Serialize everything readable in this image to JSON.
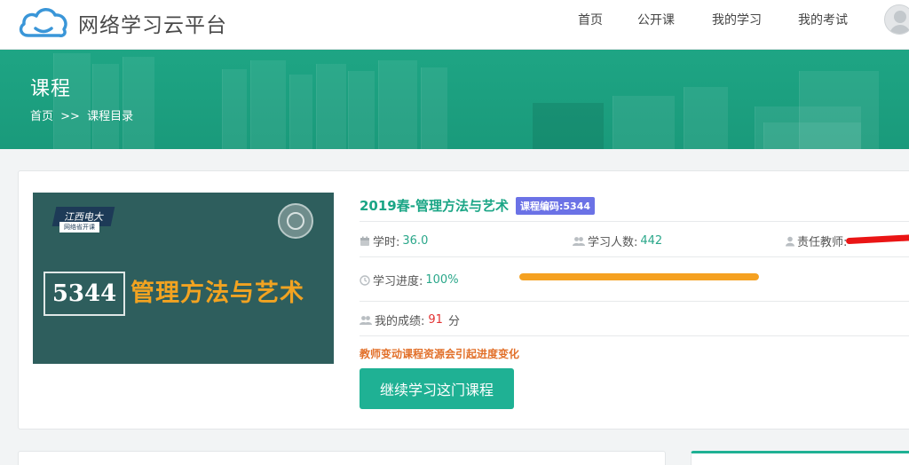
{
  "header": {
    "logo_text": "网络学习云平台",
    "nav": [
      {
        "label": "首页"
      },
      {
        "label": "公开课"
      },
      {
        "label": "我的学习"
      },
      {
        "label": "我的考试"
      }
    ]
  },
  "banner": {
    "title": "课程",
    "breadcrumb": {
      "home": "首页",
      "separator": ">>",
      "current": "课程目录"
    }
  },
  "course": {
    "cover": {
      "school": "江西电大",
      "school_sub": "网络省开课",
      "code": "5344",
      "title": "管理方法与艺术"
    },
    "title": "2019春-管理方法与艺术",
    "code_badge": "课程编码:5344",
    "hours_label": "学时:",
    "hours_value": "36.0",
    "students_label": "学习人数:",
    "students_value": "442",
    "teacher_label": "责任教师:",
    "progress_label": "学习进度:",
    "progress_value": "100%",
    "progress_fraction": 1.0,
    "score_label": "我的成绩:",
    "score_value": "91",
    "score_unit": "分",
    "notice": "教师变动课程资源会引起进度变化",
    "continue_button": "继续学习这门课程"
  },
  "colors": {
    "brand": "#1aa585",
    "button": "#1fb194",
    "progress": "#f5a121",
    "badge": "#6b72e6",
    "notice": "#e2702a",
    "score": "#e23232"
  },
  "icons": {
    "logo": "cloud-icon",
    "hours": "calendar-icon",
    "students": "users-icon",
    "teacher": "user-icon",
    "progress": "clock-icon",
    "score": "users-icon",
    "avatar": "default-avatar"
  }
}
